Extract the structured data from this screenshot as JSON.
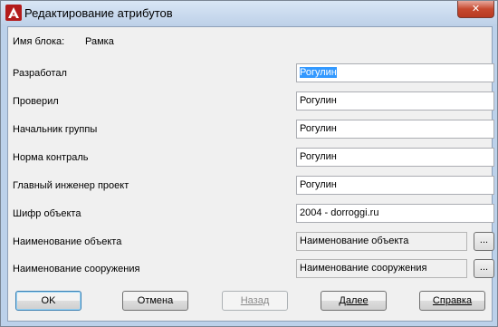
{
  "window": {
    "title": "Редактирование атрибутов",
    "close_glyph": "✕"
  },
  "block": {
    "name_label": "Имя блока:",
    "name_value": "Рамка"
  },
  "attributes": [
    {
      "label": "Разработал",
      "value": "Рогулин",
      "selected": true
    },
    {
      "label": "Проверил",
      "value": "Рогулин"
    },
    {
      "label": "Начальник группы",
      "value": "Рогулин"
    },
    {
      "label": "Норма контраль",
      "value": "Рогулин"
    },
    {
      "label": "Главный инженер проект",
      "value": "Рогулин"
    },
    {
      "label": "Шифр объекта",
      "value": "2004 - dorroggi.ru"
    },
    {
      "label": "Наименование объекта",
      "value": "Наименование объекта",
      "readonly": true,
      "button": "..."
    },
    {
      "label": "Наименование сооружения",
      "value": "Наименование сооружения",
      "readonly": true,
      "button": "..."
    }
  ],
  "buttons": {
    "ok": "OK",
    "cancel": "Отмена",
    "back": "Назад",
    "next": "Далее",
    "help": "Справка"
  },
  "colors": {
    "titlebar": "#bdd0e8",
    "selection": "#3399ff",
    "close": "#c6492f",
    "app_icon": "#c81f1f"
  },
  "icons": {
    "app": "autocad-logo-icon",
    "close": "close-icon"
  }
}
